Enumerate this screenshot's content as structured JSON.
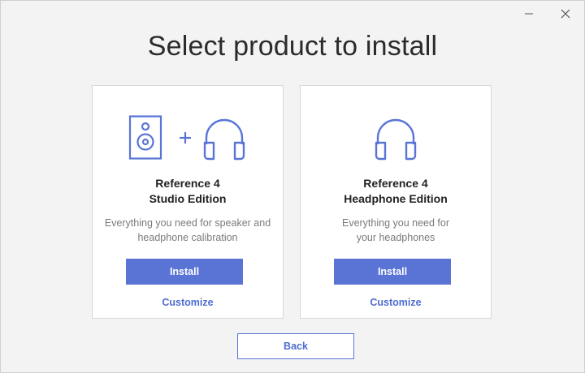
{
  "window": {
    "title": "Select product to install",
    "controls": {
      "minimize_icon": "minimize-icon",
      "close_icon": "close-icon"
    }
  },
  "products": [
    {
      "name_line1": "Reference 4",
      "name_line2": "Studio Edition",
      "desc_line1": "Everything you need for speaker and",
      "desc_line2": "headphone calibration",
      "install_label": "Install",
      "customize_label": "Customize",
      "icons": [
        "speaker-icon",
        "plus-icon",
        "headphones-icon"
      ]
    },
    {
      "name_line1": "Reference 4",
      "name_line2": "Headphone Edition",
      "desc_line1": "Everything you need for",
      "desc_line2": "your headphones",
      "install_label": "Install",
      "customize_label": "Customize",
      "icons": [
        "headphones-icon"
      ]
    }
  ],
  "footer": {
    "back_label": "Back"
  },
  "colors": {
    "accent": "#5a74d6",
    "link": "#4f6ccf",
    "icon": "#5a74d6",
    "background": "#f3f3f3"
  }
}
